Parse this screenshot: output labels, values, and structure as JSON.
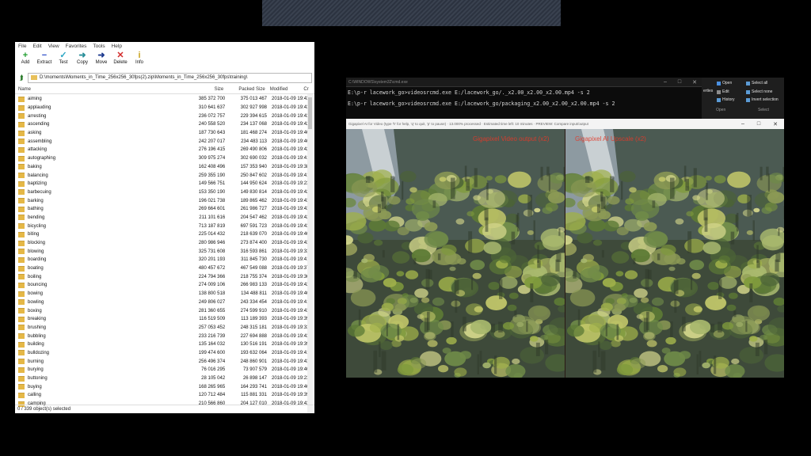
{
  "zip": {
    "menu": [
      "File",
      "Edit",
      "View",
      "Favorites",
      "Tools",
      "Help"
    ],
    "toolbar": [
      {
        "label": "Add",
        "icon": "plus-icon",
        "glyph": "+",
        "color": "#1f9e2f"
      },
      {
        "label": "Extract",
        "icon": "minus-icon",
        "glyph": "−",
        "color": "#2b4cc9"
      },
      {
        "label": "Test",
        "icon": "check-icon",
        "glyph": "✓",
        "color": "#2aa6c4"
      },
      {
        "label": "Copy",
        "icon": "copy-arrow-icon",
        "glyph": "➜",
        "color": "#2a8f9a"
      },
      {
        "label": "Move",
        "icon": "move-arrow-icon",
        "glyph": "➜",
        "color": "#1d3a8f"
      },
      {
        "label": "Delete",
        "icon": "delete-x-icon",
        "glyph": "✕",
        "color": "#d22a2a"
      },
      {
        "label": "Info",
        "icon": "info-icon",
        "glyph": "i",
        "color": "#c9a31e"
      }
    ],
    "path": "D:\\moments\\Moments_in_Time_256x256_30fps(2).zip\\Moments_in_Time_256x256_30fps\\training\\",
    "columns": {
      "name": "Name",
      "size": "Size",
      "packed": "Packed Size",
      "modified": "Modified",
      "created": "Cr"
    },
    "rows": [
      [
        "aiming",
        "385 372 700",
        "375 013 467",
        "2018-01-09 19:43"
      ],
      [
        "applauding",
        "310 641 637",
        "302 927 998",
        "2018-01-09 19:43"
      ],
      [
        "arresting",
        "236 072 757",
        "229 394 615",
        "2018-01-09 19:43"
      ],
      [
        "ascending",
        "240 558 520",
        "234 137 068",
        "2018-01-09 19:42"
      ],
      [
        "asking",
        "187 730 643",
        "181 468 274",
        "2018-01-09 19:40"
      ],
      [
        "assembling",
        "242 207 017",
        "234 483 113",
        "2018-01-09 19:40"
      ],
      [
        "attacking",
        "276 196 415",
        "269 490 806",
        "2018-01-09 19:42"
      ],
      [
        "autographing",
        "309 975 274",
        "302 690 032",
        "2018-01-09 19:41"
      ],
      [
        "baking",
        "162 408 496",
        "157 353 940",
        "2018-01-09 19:38"
      ],
      [
        "balancing",
        "259 355 190",
        "250 847 602",
        "2018-01-09 19:41"
      ],
      [
        "baptizing",
        "149 566 751",
        "144 950 624",
        "2018-01-09 19:23"
      ],
      [
        "barbecuing",
        "153 350 190",
        "149 830 814",
        "2018-01-09 19:42"
      ],
      [
        "barking",
        "196 021 738",
        "189 865 462",
        "2018-01-09 19:43"
      ],
      [
        "bathing",
        "269 664 601",
        "261 986 727",
        "2018-01-09 19:43"
      ],
      [
        "bending",
        "211 101 616",
        "204 547 462",
        "2018-01-09 19:42"
      ],
      [
        "bicycling",
        "713 187 819",
        "697 591 723",
        "2018-01-09 19:43"
      ],
      [
        "biting",
        "225 014 432",
        "218 639 070",
        "2018-01-09 19:40"
      ],
      [
        "blocking",
        "280 986 946",
        "273 874 400",
        "2018-01-09 19:43"
      ],
      [
        "blowing",
        "325 731 608",
        "316 593 861",
        "2018-01-09 19:33"
      ],
      [
        "boarding",
        "320 201 193",
        "311 845 730",
        "2018-01-09 19:41"
      ],
      [
        "boating",
        "480 457 672",
        "467 549 088",
        "2018-01-09 19:37"
      ],
      [
        "boiling",
        "224 794 366",
        "218 755 374",
        "2018-01-09 19:36"
      ],
      [
        "bouncing",
        "274 009 106",
        "266 983 133",
        "2018-01-09 19:42"
      ],
      [
        "bowing",
        "138 800 518",
        "134 488 811",
        "2018-01-09 19:40"
      ],
      [
        "bowling",
        "249 806 027",
        "243 334 454",
        "2018-01-09 19:41"
      ],
      [
        "boxing",
        "281 360 655",
        "274 599 910",
        "2018-01-09 19:43"
      ],
      [
        "breaking",
        "116 519 509",
        "113 189 393",
        "2018-01-09 19:39"
      ],
      [
        "brushing",
        "257 053 452",
        "248 315 181",
        "2018-01-09 19:33"
      ],
      [
        "bubbling",
        "233 216 739",
        "227 694 888",
        "2018-01-09 19:43"
      ],
      [
        "building",
        "135 164 032",
        "130 516 191",
        "2018-01-09 19:39"
      ],
      [
        "bulldozing",
        "199 474 600",
        "193 632 064",
        "2018-01-09 19:41"
      ],
      [
        "burning",
        "256 496 374",
        "248 860 901",
        "2018-01-09 19:43"
      ],
      [
        "burying",
        "76 016 295",
        "73 907 579",
        "2018-01-09 19:40"
      ],
      [
        "buttoning",
        "28 105 042",
        "26 898 147",
        "2018-01-09 19:23"
      ],
      [
        "buying",
        "168 265 965",
        "164 293 741",
        "2018-01-09 19:40"
      ],
      [
        "calling",
        "120 712 484",
        "115 881 331",
        "2018-01-09 19:39"
      ],
      [
        "camping",
        "210 566 860",
        "204 127 010",
        "2018-01-09 19:43"
      ]
    ],
    "status": "0 / 339 object(s) selected"
  },
  "cmd": {
    "title": "C:\\WINDOWS\\system32\\cmd.exe",
    "lines": [
      "E:\\p-r lacework_go>videosrcmd.exe E:/lacework_go/._x2.00_x2.00_x2.00.mp4 -s 2",
      "E:\\p-r lacework_go>videosrcmd.exe E:/lacework_go/packaging_x2.00_x2.00_x2.00.mp4 -s 2"
    ]
  },
  "ribbon": {
    "open": "Open",
    "edit": "Edit",
    "history": "History",
    "select_all": "Select all",
    "select_none": "Select none",
    "invert_selection": "Invert selection",
    "group_open": "Open",
    "group_select": "Select",
    "properties": "erties"
  },
  "preview": {
    "title": "Gigapixel AI for Video (type 'h' for help, 'q' to quit, 'p' to pause)  ·  13.000% processed  ·  Estimated time left: 10 minutes  ·  PREVIEW: Compare input/output",
    "left_label": "Gigapixel Video output (x2)",
    "right_label": "Gigapixel AI Upscale (x2)"
  }
}
